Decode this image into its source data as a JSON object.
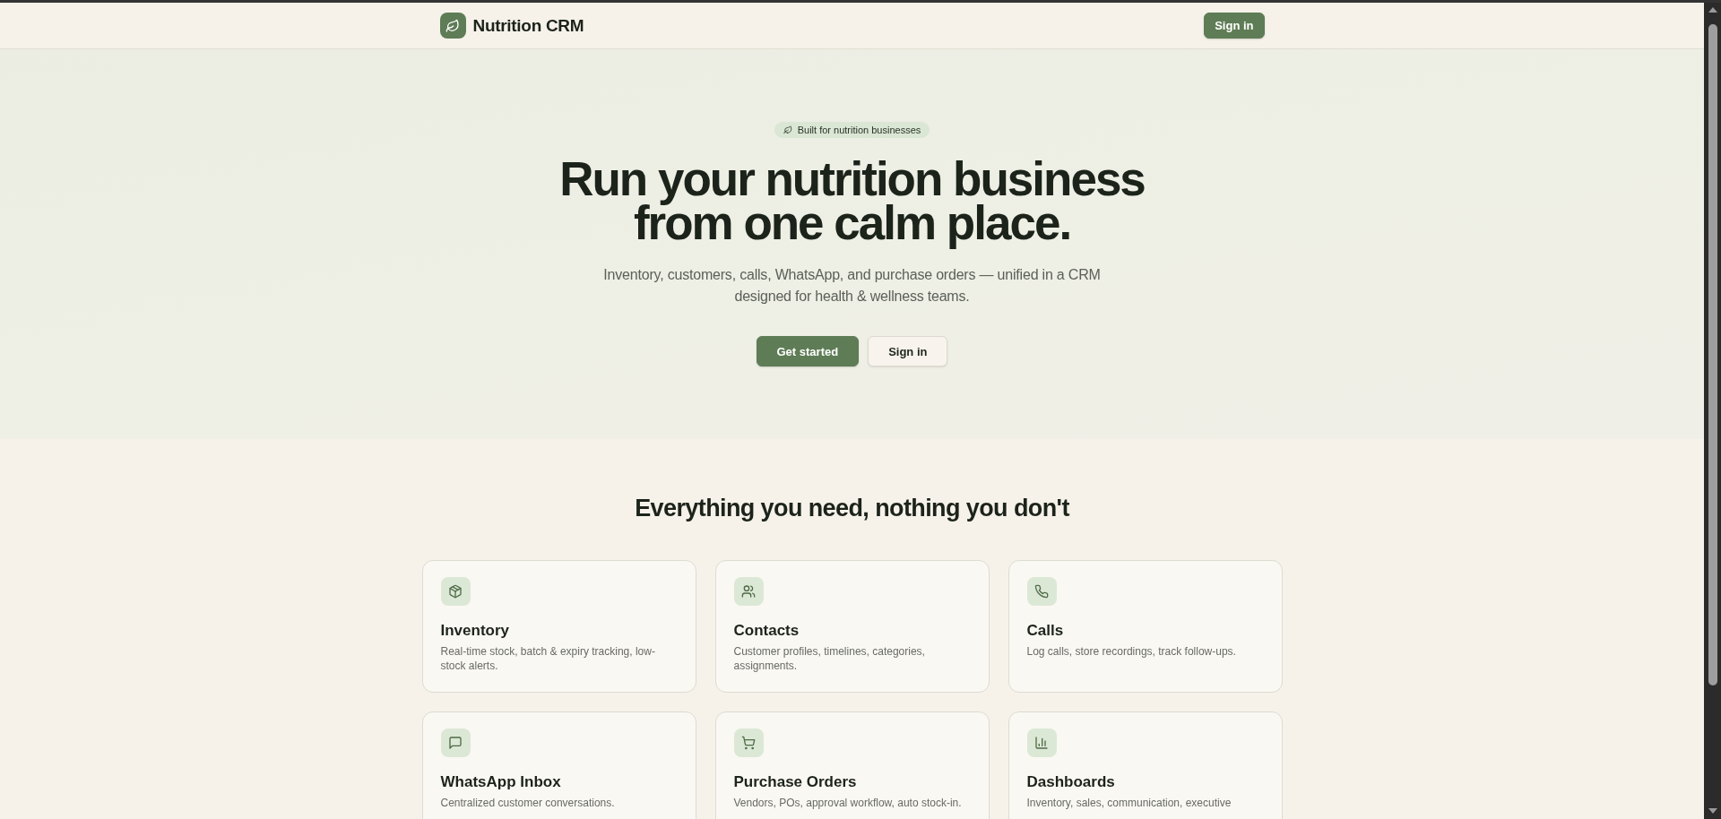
{
  "header": {
    "brand": "Nutrition CRM",
    "sign_in_button": "Sign in"
  },
  "hero": {
    "badge": "Built for nutrition businesses",
    "title": "Run your nutrition business from one calm place.",
    "subtitle": "Inventory, customers, calls, WhatsApp, and purchase orders — unified in a CRM designed for health & wellness teams.",
    "buttons": [
      {
        "label": "Get started",
        "kind": "primary"
      },
      {
        "label": "Sign in",
        "kind": "secondary"
      }
    ]
  },
  "features": {
    "heading": "Everything you need, nothing you don't",
    "cards": [
      {
        "title": "Inventory",
        "description": "Real-time stock, batch & expiry tracking, low-stock alerts."
      },
      {
        "title": "Contacts",
        "description": "Customer profiles, timelines, categories, assignments."
      },
      {
        "title": "Calls",
        "description": "Log calls, store recordings, track follow-ups."
      },
      {
        "title": "WhatsApp Inbox",
        "description": "Centralized customer conversations."
      },
      {
        "title": "Purchase Orders",
        "description": "Vendors, POs, approval workflow, auto stock-in."
      },
      {
        "title": "Dashboards",
        "description": "Inventory, sales, communication, executive"
      }
    ]
  }
}
